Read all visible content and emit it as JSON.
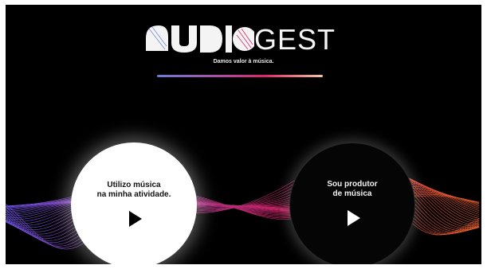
{
  "brand": {
    "logo_text": "GEST",
    "logo_prefix": "AUDIO",
    "tagline": "Damos valor à música."
  },
  "choices": [
    {
      "label_line1": "Utilizo música",
      "label_line2": "na minha atividade.",
      "icon": "play-icon"
    },
    {
      "label_line1": "Sou produtor",
      "label_line2": "de música",
      "icon": "play-icon"
    }
  ],
  "colors": {
    "background": "#000000",
    "wave_purple": "#7b5cff",
    "wave_pink": "#e0246b",
    "wave_orange": "#ff6a2e",
    "line_start": "#6b7bd8",
    "line_mid": "#e0246b",
    "line_end": "#f3c9a0"
  }
}
